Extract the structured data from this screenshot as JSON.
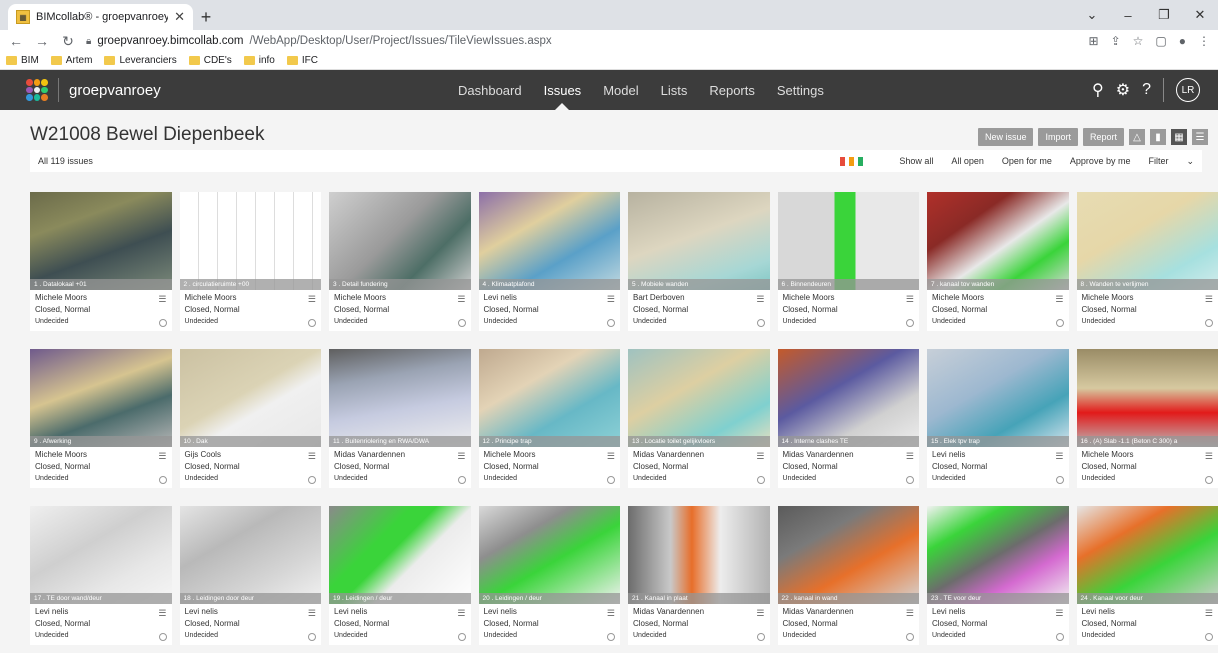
{
  "browser": {
    "tab_title": "BIMcollab® - groepvanroey",
    "url_host": "groepvanroey.bimcollab.com",
    "url_path": "/WebApp/Desktop/User/Project/Issues/TileViewIssues.aspx",
    "bookmarks": [
      "BIM",
      "Artem",
      "Leveranciers",
      "CDE's",
      "info",
      "IFC"
    ]
  },
  "app": {
    "brand": "groepvanroey",
    "nav": [
      "Dashboard",
      "Issues",
      "Model",
      "Lists",
      "Reports",
      "Settings"
    ],
    "active_nav": "Issues",
    "avatar": "LR"
  },
  "page": {
    "title": "W21008 Bewel Diepenbeek",
    "buttons": {
      "new_issue": "New issue",
      "import": "Import",
      "report": "Report"
    },
    "issue_count": "All 119 issues",
    "filters": [
      "Show all",
      "All open",
      "Open for me",
      "Approve by me",
      "Filter"
    ],
    "flag_colors": [
      "#e74c3c",
      "#f39c12",
      "#27ae60"
    ]
  },
  "issues": [
    {
      "caption": "1 . Datalokaal +01",
      "user": "Michele Moors",
      "status": "Closed, Normal",
      "decision": "Undecided",
      "thumb": "t1"
    },
    {
      "caption": "2 . circulatieruimte +00",
      "user": "Michele Moors",
      "status": "Closed, Normal",
      "decision": "Undecided",
      "thumb": "t2"
    },
    {
      "caption": "3 . Detail fundering",
      "user": "Michele Moors",
      "status": "Closed, Normal",
      "decision": "Undecided",
      "thumb": "t3"
    },
    {
      "caption": "4 . Klimaatplafond",
      "user": "Levi nelis",
      "status": "Closed, Normal",
      "decision": "Undecided",
      "thumb": "t4"
    },
    {
      "caption": "5 . Mobiele wanden",
      "user": "Bart Derboven",
      "status": "Closed, Normal",
      "decision": "Undecided",
      "thumb": "t5"
    },
    {
      "caption": "6 . Binnendeuren",
      "user": "Michele Moors",
      "status": "Closed, Normal",
      "decision": "Undecided",
      "thumb": "t6"
    },
    {
      "caption": "7 . kanaal tov wanden",
      "user": "Michele Moors",
      "status": "Closed, Normal",
      "decision": "Undecided",
      "thumb": "t7"
    },
    {
      "caption": "8 . Wanden te verlijmen",
      "user": "Michele Moors",
      "status": "Closed, Normal",
      "decision": "Undecided",
      "thumb": "t8"
    },
    {
      "caption": "9 . Afwerking",
      "user": "Michele Moors",
      "status": "Closed, Normal",
      "decision": "Undecided",
      "thumb": "t9"
    },
    {
      "caption": "10 . Dak",
      "user": "Gijs Cools",
      "status": "Closed, Normal",
      "decision": "Undecided",
      "thumb": "t10"
    },
    {
      "caption": "11 . Buitenriolering en RWA/DWA",
      "user": "Midas Vanardennen",
      "status": "Closed, Normal",
      "decision": "Undecided",
      "thumb": "t11"
    },
    {
      "caption": "12 . Principe trap",
      "user": "Michele Moors",
      "status": "Closed, Normal",
      "decision": "Undecided",
      "thumb": "t12"
    },
    {
      "caption": "13 . Locatie toilet gelijkvloers",
      "user": "Midas Vanardennen",
      "status": "Closed, Normal",
      "decision": "Undecided",
      "thumb": "t13"
    },
    {
      "caption": "14 . Interne clashes TE",
      "user": "Midas Vanardennen",
      "status": "Closed, Normal",
      "decision": "Undecided",
      "thumb": "t14"
    },
    {
      "caption": "15 . Elek tpv trap",
      "user": "Levi nelis",
      "status": "Closed, Normal",
      "decision": "Undecided",
      "thumb": "t15"
    },
    {
      "caption": "16 . (A) Slab -1.1 (Beton C 300) a",
      "user": "Michele Moors",
      "status": "Closed, Normal",
      "decision": "Undecided",
      "thumb": "t16"
    },
    {
      "caption": "17 . TE door wand/deur",
      "user": "Levi nelis",
      "status": "Closed, Normal",
      "decision": "Undecided",
      "thumb": "t17"
    },
    {
      "caption": "18 . Leidingen door deur",
      "user": "Levi nelis",
      "status": "Closed, Normal",
      "decision": "Undecided",
      "thumb": "t18"
    },
    {
      "caption": "19 . Leidingen / deur",
      "user": "Levi nelis",
      "status": "Closed, Normal",
      "decision": "Undecided",
      "thumb": "t19"
    },
    {
      "caption": "20 . Leidingen / deur",
      "user": "Levi nelis",
      "status": "Closed, Normal",
      "decision": "Undecided",
      "thumb": "t20"
    },
    {
      "caption": "21 . Kanaal in plaat",
      "user": "Midas Vanardennen",
      "status": "Closed, Normal",
      "decision": "Undecided",
      "thumb": "t21"
    },
    {
      "caption": "22 . kanaal in wand",
      "user": "Midas Vanardennen",
      "status": "Closed, Normal",
      "decision": "Undecided",
      "thumb": "t22"
    },
    {
      "caption": "23 . TE voor deur",
      "user": "Levi nelis",
      "status": "Closed, Normal",
      "decision": "Undecided",
      "thumb": "t23"
    },
    {
      "caption": "24 . Kanaal voor deur",
      "user": "Levi nelis",
      "status": "Closed, Normal",
      "decision": "Undecided",
      "thumb": "t24"
    }
  ]
}
